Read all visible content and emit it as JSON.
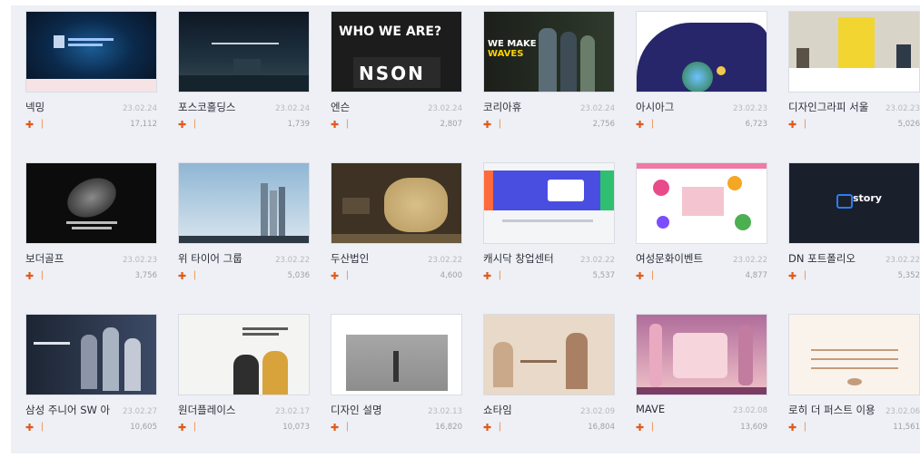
{
  "cards": [
    {
      "title": "넥밍",
      "date": "23.02.24",
      "views": "17,112",
      "thumb_text": "",
      "colors": [
        "#08111f",
        "#1b5c95"
      ]
    },
    {
      "title": "포스코홀딩스",
      "date": "23.02.24",
      "views": "1,739",
      "thumb_text": "",
      "colors": [
        "#142030",
        "#3a5560"
      ]
    },
    {
      "title": "엔슨",
      "date": "23.02.24",
      "views": "2,807",
      "thumb_text": "WHO WE ARE?",
      "thumb_text2": "NSON",
      "colors": [
        "#1c1c1c",
        "#3b3b3b"
      ]
    },
    {
      "title": "코리아휴",
      "date": "23.02.24",
      "views": "2,756",
      "thumb_text": "WE MAKE WAVES",
      "colors": [
        "#1d211c",
        "#2f3a2c"
      ]
    },
    {
      "title": "아시아그",
      "date": "23.02.23",
      "views": "6,723",
      "thumb_text": "",
      "colors": [
        "#27266b",
        "#ffffff"
      ]
    },
    {
      "title": "디자인그라피 서울",
      "date": "23.02.23",
      "views": "5,026",
      "thumb_text": "",
      "colors": [
        "#d9d4c8",
        "#f2d530"
      ]
    },
    {
      "title": "보더골프",
      "date": "23.02.23",
      "views": "3,756",
      "thumb_text": "",
      "colors": [
        "#0c0c0c",
        "#2a2a2a"
      ]
    },
    {
      "title": "위 타이어 그룹",
      "date": "23.02.22",
      "views": "5,036",
      "thumb_text": "",
      "colors": [
        "#8fb6d4",
        "#d8e5ee"
      ]
    },
    {
      "title": "두산법인",
      "date": "23.02.22",
      "views": "4,600",
      "thumb_text": "",
      "colors": [
        "#3d3223",
        "#b89a62"
      ]
    },
    {
      "title": "캐시닥 창업센터",
      "date": "23.02.22",
      "views": "5,537",
      "thumb_text": "",
      "colors": [
        "#4a4ee0",
        "#f4f5f7"
      ]
    },
    {
      "title": "여성문화이벤트",
      "date": "23.02.22",
      "views": "4,877",
      "thumb_text": "",
      "colors": [
        "#f4c5d0",
        "#ffffff"
      ]
    },
    {
      "title": "DN 포트폴리오",
      "date": "23.02.22",
      "views": "5,352",
      "thumb_text": "story",
      "colors": [
        "#1a1f2c",
        "#2d7bf0"
      ]
    },
    {
      "title": "삼성 주니어 SW 아",
      "date": "23.02.27",
      "views": "10,605",
      "thumb_text": "",
      "colors": [
        "#1d2533",
        "#3c4a66"
      ]
    },
    {
      "title": "원더플레이스",
      "date": "23.02.17",
      "views": "10,073",
      "thumb_text": "",
      "colors": [
        "#f4f4f2",
        "#d9a33b"
      ]
    },
    {
      "title": "디자인 설명",
      "date": "23.02.13",
      "views": "16,820",
      "thumb_text": "",
      "colors": [
        "#ffffff",
        "#8d8d8d"
      ]
    },
    {
      "title": "쇼타임",
      "date": "23.02.09",
      "views": "16,804",
      "thumb_text": "",
      "colors": [
        "#e8d9c8",
        "#c9a98a"
      ]
    },
    {
      "title": "MAVE",
      "date": "23.02.08",
      "views": "13,609",
      "thumb_text": "",
      "colors": [
        "#b06d9b",
        "#f1c2c8"
      ]
    },
    {
      "title": "로히 더 퍼스트 이용",
      "date": "23.02.06",
      "views": "11,561",
      "thumb_text": "",
      "colors": [
        "#faf3ec",
        "#c59c7a"
      ]
    }
  ]
}
